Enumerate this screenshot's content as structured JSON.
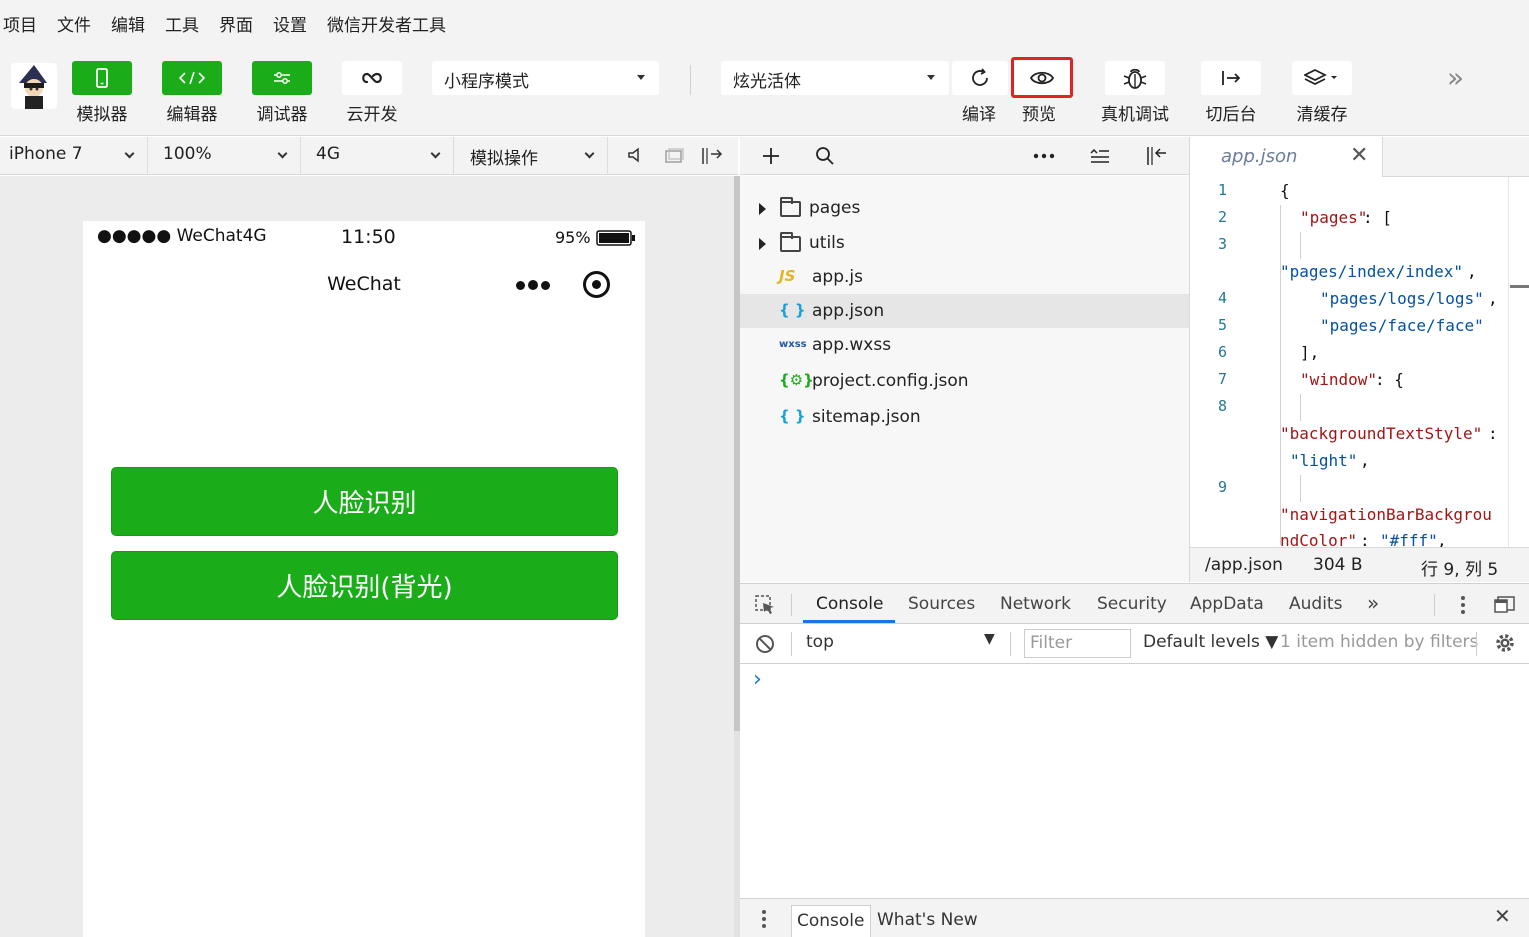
{
  "menu": [
    "项目",
    "文件",
    "编辑",
    "工具",
    "界面",
    "设置",
    "微信开发者工具"
  ],
  "toolbar": {
    "simulator_label": "模拟器",
    "editor_label": "编辑器",
    "debugger_label": "调试器",
    "cloud_label": "云开发",
    "mode_value": "小程序模式",
    "compile_mode_value": "炫光活体",
    "compile_label": "编译",
    "preview_label": "预览",
    "remote_debug_label": "真机调试",
    "background_label": "切后台",
    "clear_cache_label": "清缓存",
    "more": "»"
  },
  "simulator_bar": {
    "device": "iPhone 7",
    "zoom": "100%",
    "network": "4G",
    "operation": "模拟操作"
  },
  "phone": {
    "signal": "●●●●● WeChat4G",
    "time": "11:50",
    "battery": "95%",
    "nav_title": "WeChat",
    "button_face": "人脸识别",
    "button_face_backlight": "人脸识别(背光)"
  },
  "file_tree": [
    {
      "name": "pages",
      "type": "folder"
    },
    {
      "name": "utils",
      "type": "folder"
    },
    {
      "name": "app.js",
      "type": "js",
      "icon": "JS"
    },
    {
      "name": "app.json",
      "type": "json",
      "icon": "{ }",
      "selected": true
    },
    {
      "name": "app.wxss",
      "type": "wxss",
      "icon": "wxss"
    },
    {
      "name": "project.config.json",
      "type": "config",
      "icon": "{⚙}"
    },
    {
      "name": "sitemap.json",
      "type": "json",
      "icon": "{ }"
    }
  ],
  "editor": {
    "tab_name": "app.json",
    "line_numbers": [
      "1",
      "2",
      "3",
      "4",
      "5",
      "6",
      "7",
      "8",
      "9"
    ],
    "code": {
      "l1": "{",
      "l2_key": "\"pages\"",
      "l2_rest": ": [",
      "l3": "\"pages/index/index\"",
      "l3_rest": ",",
      "l4": "\"pages/logs/logs\"",
      "l4_rest": ",",
      "l5": "\"pages/face/face\"",
      "l6": "],",
      "l7_key": "\"window\"",
      "l7_rest": ": {",
      "l8_key": "\"backgroundTextStyle\"",
      "l8_rest": ":",
      "l8_val": "\"light\"",
      "l8_val_rest": ",",
      "l9_key": "\"navigationBarBackgrou",
      "l9_key2": "ndColor\"",
      "l9_rest": ": ",
      "l9_val": "\"#fff\"",
      "l9_val_rest": ","
    },
    "status_path": "/app.json",
    "status_size": "304 B",
    "status_cursor": "行 9, 列 5"
  },
  "devtools": {
    "tabs": [
      "Console",
      "Sources",
      "Network",
      "Security",
      "AppData",
      "Audits"
    ],
    "active_tab": "Console",
    "context": "top",
    "filter_placeholder": "Filter",
    "levels": "Default levels ▼",
    "hidden": "1 item hidden by filters",
    "prompt": "›",
    "drawer_tabs": [
      "Console",
      "What's New"
    ]
  },
  "colors": {
    "brand_green": "#1aad19",
    "highlight_red": "#e02424",
    "devtools_blue": "#1a73e8"
  }
}
